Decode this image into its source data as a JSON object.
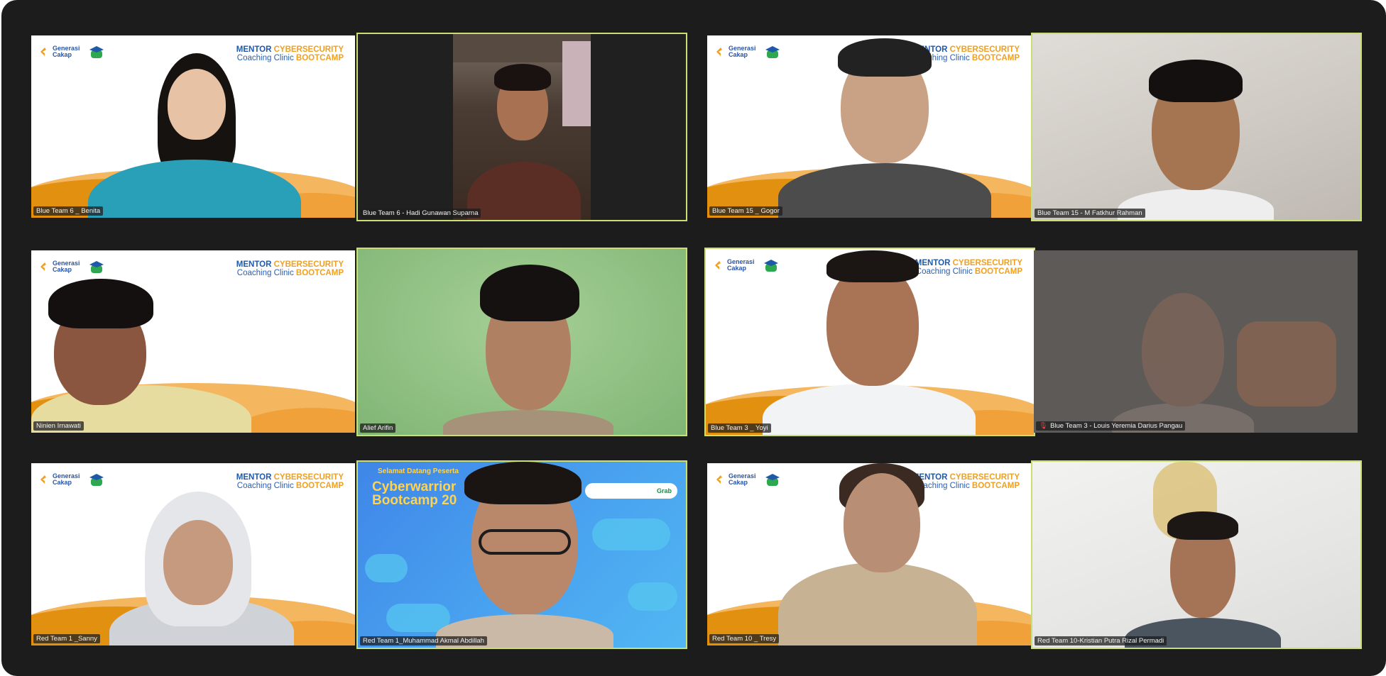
{
  "branding": {
    "logo_line1": "Generasi",
    "logo_line2": "Cakap",
    "event_line1_a": "MENTOR",
    "event_line1_b": "CYBERSECURITY",
    "event_line2_a": "Coaching Clinic",
    "event_line2_b": "BOOTCAMP"
  },
  "banner": {
    "welcome": "Selamat Datang Peserta",
    "title_line1": "Cyberwarrior",
    "title_line2": "Bootcamp 20",
    "partner": "Grab"
  },
  "participants": [
    {
      "name": "Blue Team 6 _ Benita"
    },
    {
      "name": "Blue Team 6 - Hadi Gunawan Suparna"
    },
    {
      "name": "Blue Team 15 _ Gogor"
    },
    {
      "name": "Blue Team 15 - M Fatkhur Rahman"
    },
    {
      "name": "Ninien Irnawati"
    },
    {
      "name": "Alief Arifin"
    },
    {
      "name": "Blue Team 3 _ Yoyi"
    },
    {
      "name": "Blue Team 3 - Louis Yeremia Darius Pangau"
    },
    {
      "name": "Red Team 1 _Sanny"
    },
    {
      "name": "Red Team 1_Muhammad Akmal Abdillah"
    },
    {
      "name": "Red Team 10 _ Tresy"
    },
    {
      "name": "Red Team 10-Kristian Putra Rizal Permadi"
    }
  ],
  "colors": {
    "window_bg": "#1c1c1c",
    "active_speaker_border": "#c9df74",
    "brand_blue": "#1f5aa8",
    "brand_orange": "#f0a020",
    "muted_icon": "#e04646"
  },
  "icons": {
    "logo": "generasi-cakap-logo-icon",
    "cap": "graduation-cap-icon",
    "muted": "mic-muted-icon"
  }
}
